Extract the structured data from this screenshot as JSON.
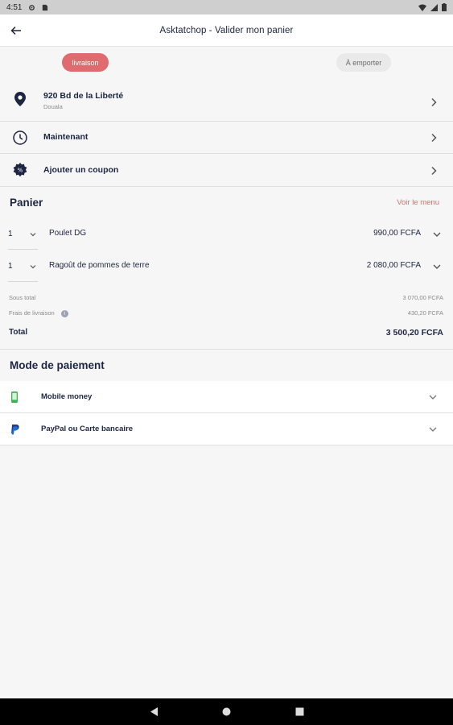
{
  "status_bar": {
    "time": "4:51"
  },
  "app_bar": {
    "title": "Asktatchop - Valider mon panier"
  },
  "mode": {
    "delivery_label": "livraison",
    "takeaway_label": "À emporter"
  },
  "address": {
    "line": "920 Bd de la Liberté",
    "city": "Douala"
  },
  "time_option": {
    "label": "Maintenant"
  },
  "coupon": {
    "label": "Ajouter un coupon"
  },
  "cart": {
    "title": "Panier",
    "menu_link": "Voir le menu",
    "items": [
      {
        "qty": "1",
        "name": "Poulet DG",
        "price": "990,00 FCFA"
      },
      {
        "qty": "1",
        "name": "Ragoût de pommes de terre",
        "price": "2 080,00 FCFA"
      }
    ],
    "subtotal_label": "Sous total",
    "subtotal_value": "3 070,00 FCFA",
    "delivery_fee_label": "Frais de livraison",
    "delivery_fee_value": "430,20 FCFA",
    "total_label": "Total",
    "total_value": "3 500,20 FCFA"
  },
  "payment": {
    "title": "Mode de paiement",
    "methods": [
      {
        "name": "Mobile money",
        "icon": "mobile-phone-icon"
      },
      {
        "name": "PayPal ou Carte bancaire",
        "icon": "paypal-icon"
      }
    ]
  },
  "colors": {
    "accent": "#e06b6e",
    "navy": "#1c2541",
    "mobile_money_green": "#3fb34f",
    "paypal_blue": "#1f6fd1"
  }
}
